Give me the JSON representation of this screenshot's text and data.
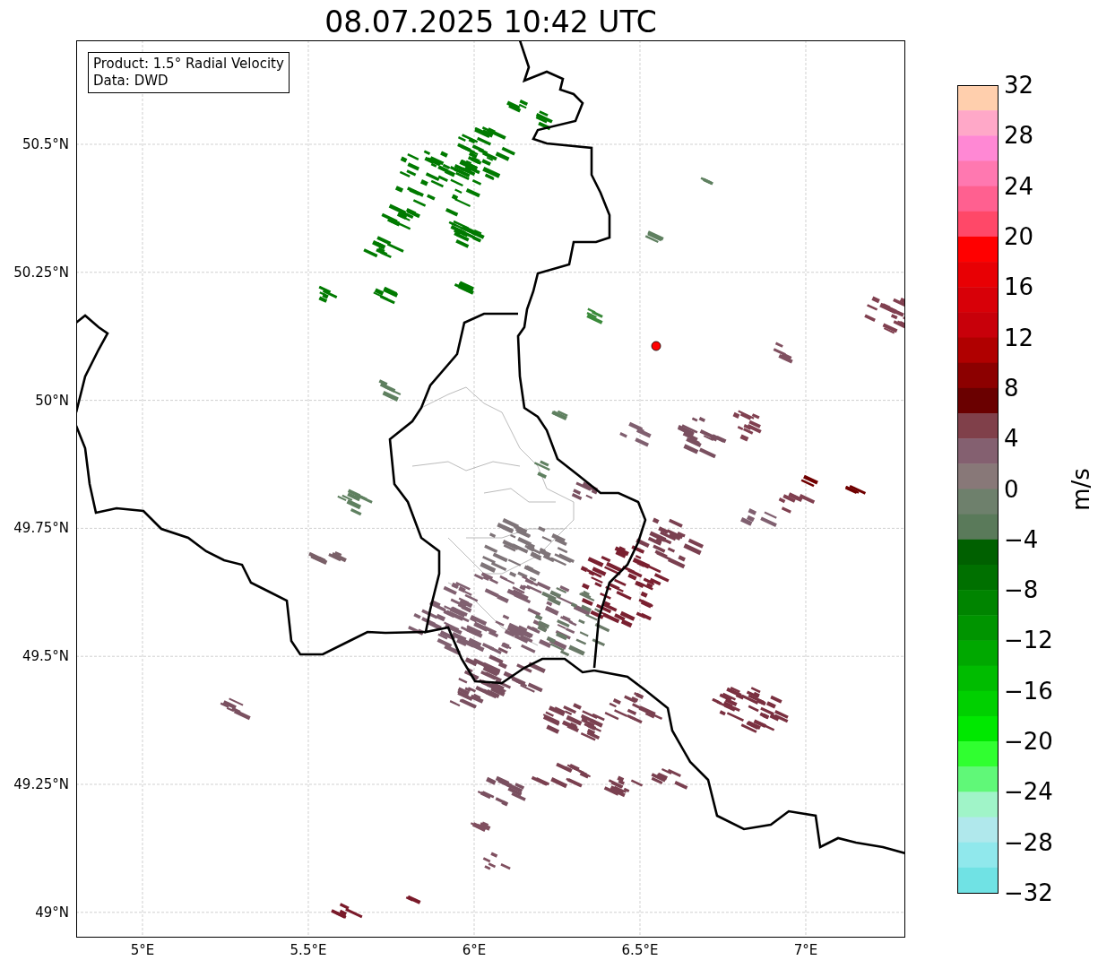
{
  "title": "08.07.2025 10:42 UTC",
  "info_box": {
    "lines": [
      "Product: 1.5° Radial Velocity",
      "Data: DWD"
    ]
  },
  "map": {
    "lat_labels": [
      "50.5°N",
      "50.25°N",
      "50°N",
      "49.75°N",
      "49.5°N",
      "49.25°N",
      "49°N"
    ],
    "lon_labels": [
      "5°E",
      "5.5°E",
      "6°E",
      "6.5°E",
      "7°E"
    ]
  },
  "colorbar": {
    "label": "m/s",
    "ticks": [
      "32",
      "28",
      "24",
      "20",
      "16",
      "12",
      "8",
      "4",
      "0",
      "−4",
      "−8",
      "−12",
      "−16",
      "−20",
      "−24",
      "−28",
      "−32"
    ]
  }
}
